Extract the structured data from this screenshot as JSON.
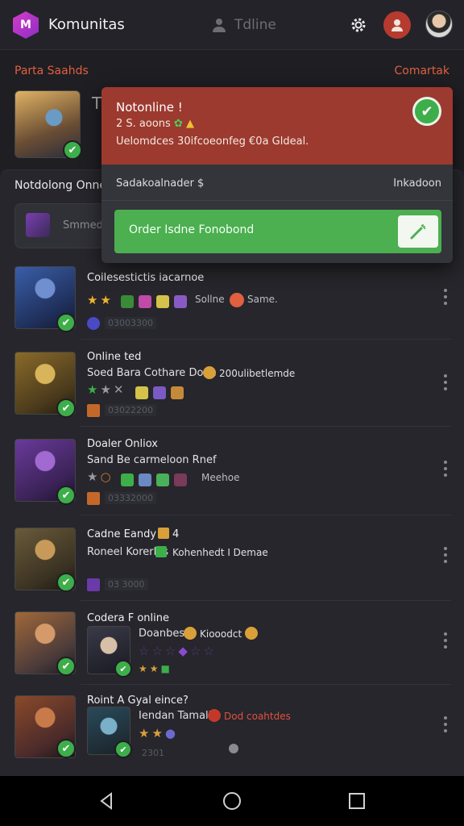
{
  "header": {
    "app_title": "Komunitas",
    "presence_label": "Tdline"
  },
  "section": {
    "left_label": "Parta Saahds",
    "right_label": "Comartak"
  },
  "panel": {
    "title": "Notdolong Onne",
    "search_text": "Smmedes"
  },
  "popup": {
    "title": "Notonline !",
    "subtitle": "2 S. aoons",
    "description": "Uelomdces 30ifcoeonfeg €0a Gldeal.",
    "row_left": "Sadakoalnader $",
    "row_right": "Inkadoon",
    "action_label": "Order Isdne Fonobond"
  },
  "rows": [
    {
      "title": "Coilesestictis iacarnoe",
      "meta": "Sollne",
      "meta2": "Same.",
      "id": "03003300"
    },
    {
      "title": "Online ted",
      "sub": "Soed Bara Cothare Done",
      "meta": "200ulibetlemde",
      "id": "03022200"
    },
    {
      "title": "Doaler Onliox",
      "sub": "Sand Be carmeloon Rnef",
      "meta": "Meehoe",
      "id": "03332000"
    },
    {
      "title": "Cadne Eandy",
      "title_suffix": "4",
      "sub": "Roneel Korerles",
      "meta": "Kohenhedt I Demae",
      "id": "03 3000"
    },
    {
      "title": "Codera F online",
      "sub": "Doanbes",
      "meta": "Kiooodct",
      "id": ""
    },
    {
      "title": "Roint A Gyal eince?",
      "sub": "Iendan Tamalle",
      "meta": "Dod coahtdes",
      "id": "2301"
    }
  ],
  "colors": {
    "accent": "#e0603f",
    "popup_header": "#9c3a2f",
    "success": "#4caf50",
    "background": "#1e1e23"
  },
  "icons": [
    "logo-icon",
    "user-icon",
    "gear-icon",
    "notification-avatar",
    "profile-avatar",
    "check-icon",
    "wand-icon",
    "kebab-icon",
    "back-icon",
    "home-icon",
    "recents-icon"
  ]
}
